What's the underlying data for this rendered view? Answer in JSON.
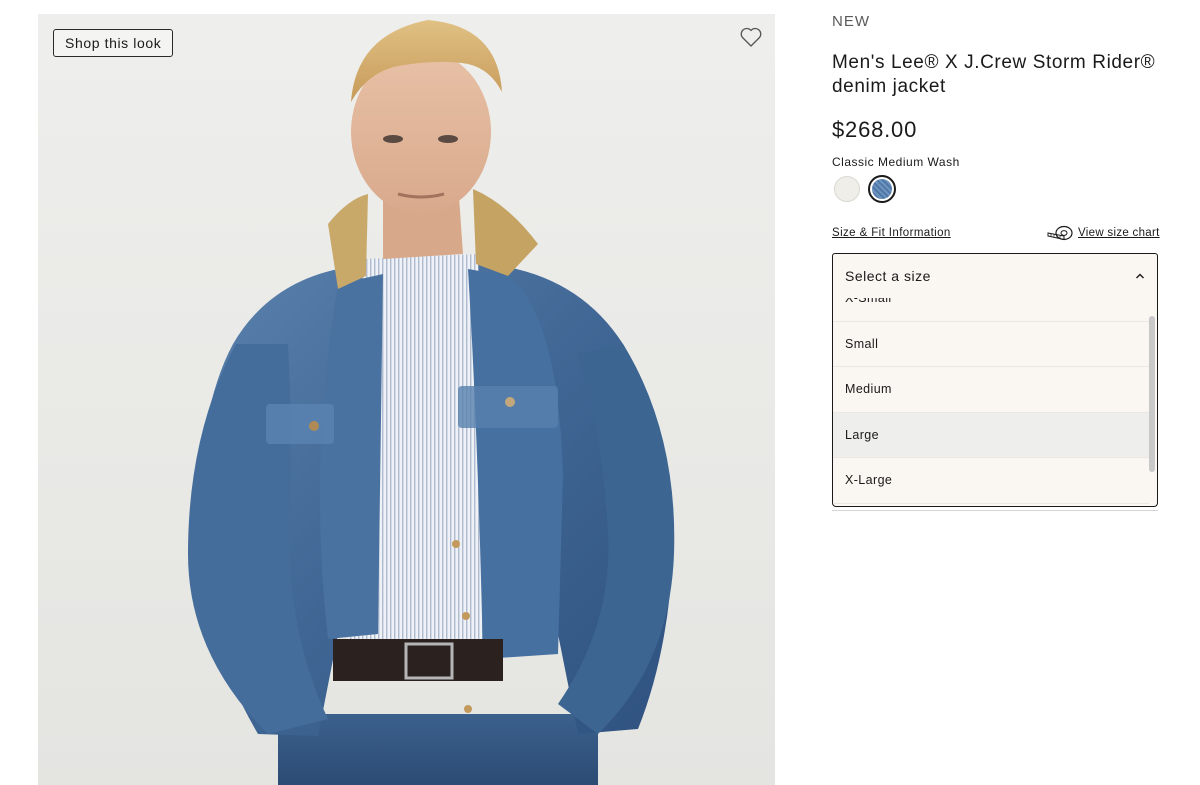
{
  "media": {
    "shop_button_label": "Shop this look",
    "favorite_icon": "heart-outline-icon",
    "background_color": "#ebebe8"
  },
  "product": {
    "badge": "NEW",
    "title": "Men's Lee® X J.Crew Storm Rider® denim jacket",
    "price": "$268.00",
    "color_name": "Classic Medium Wash",
    "swatches": [
      {
        "name": "cream",
        "color": "#efeee8",
        "selected": false
      },
      {
        "name": "classic-medium-wash",
        "color": "#5b82b0",
        "selected": true
      }
    ]
  },
  "sizing": {
    "info_link": "Size & Fit Information",
    "chart_link": "View size chart",
    "chart_icon": "measuring-tape-icon",
    "select_placeholder": "Select a size",
    "options": [
      "X-Small",
      "Small",
      "Medium",
      "Large",
      "X-Large"
    ],
    "hovered_option": "Large"
  },
  "colors": {
    "text": "#1a1a1a",
    "dropdown_bg": "#faf6f2",
    "hover_bg": "#eeeeec"
  }
}
